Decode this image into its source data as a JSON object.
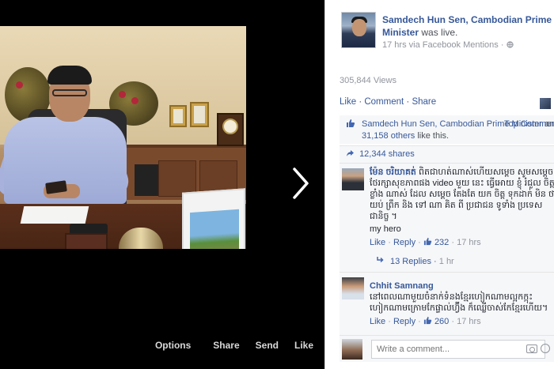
{
  "post": {
    "author": "Samdech Hun Sen, Cambodian Prime Minister",
    "status": "was live.",
    "time": "17 hrs via Facebook Mentions",
    "separator": "·",
    "views": "305,844 Views",
    "actions": {
      "like": "Like",
      "comment": "Comment",
      "share": "Share",
      "sep": "·"
    },
    "likes_line": {
      "page": "Samdech Hun Sen, Cambodian Prime Minister",
      "and": "and",
      "others": "31,158 others",
      "tail": "like this."
    },
    "top_comments": "Top Comments",
    "shares": "12,344 shares"
  },
  "video": {
    "actions": {
      "options": "Options",
      "share": "Share",
      "send": "Send",
      "like": "Like"
    }
  },
  "comments": [
    {
      "name": "ម៉ែន ចរិយាគត់",
      "text": "ពិតជាហត់ណាស់ហើយសម្ដេច សូមសម្ដេចថែរក្សាសុខភាពផង video មួយ នេះ ធ្វើអោយ ខ្ញុំ រំជួល ចិត្ត ខ្លាំង ណាស់ ដែល សម្ដេច តែងតែ យក ចិត្ត ទុកដាក់ មិន ថា យប់ ព្រឹក និង ទៅ ណា គិត ពី ប្រជាជន ទូទាំង ប្រទេស ជានិច្ច ។",
      "extra": "my hero",
      "like": "Like",
      "reply": "Reply",
      "likes": "232",
      "time": "17 hrs"
    },
    {
      "name": "Chhit Samnang",
      "text": "នៅពេលណាមួយចំនាក់ទំនងខ្មែរហៀកណាមល្អកក្កុះ ហៀកណាមក្រោមកែផ្ទាល់ហ្វ៊ីង ក៏ឈ្លើចាស់កែខ្មែរហើយ។",
      "like": "Like",
      "reply": "Reply",
      "likes": "260",
      "time": "17 hrs"
    }
  ],
  "replies": {
    "label": "13 Replies",
    "time": "1 hr"
  },
  "composer": {
    "placeholder": "Write a comment..."
  },
  "icons": {
    "next": "chevron-right-icon",
    "globe": "globe-icon",
    "like": "thumbs-up-icon",
    "share": "share-arrow-icon",
    "reply": "reply-arrow-icon",
    "camera": "camera-icon",
    "emoji": "emoji-icon"
  },
  "colors": {
    "link": "#365899",
    "muted": "#90949c",
    "panel": "#f6f7f9",
    "video_bg": "#000000"
  }
}
